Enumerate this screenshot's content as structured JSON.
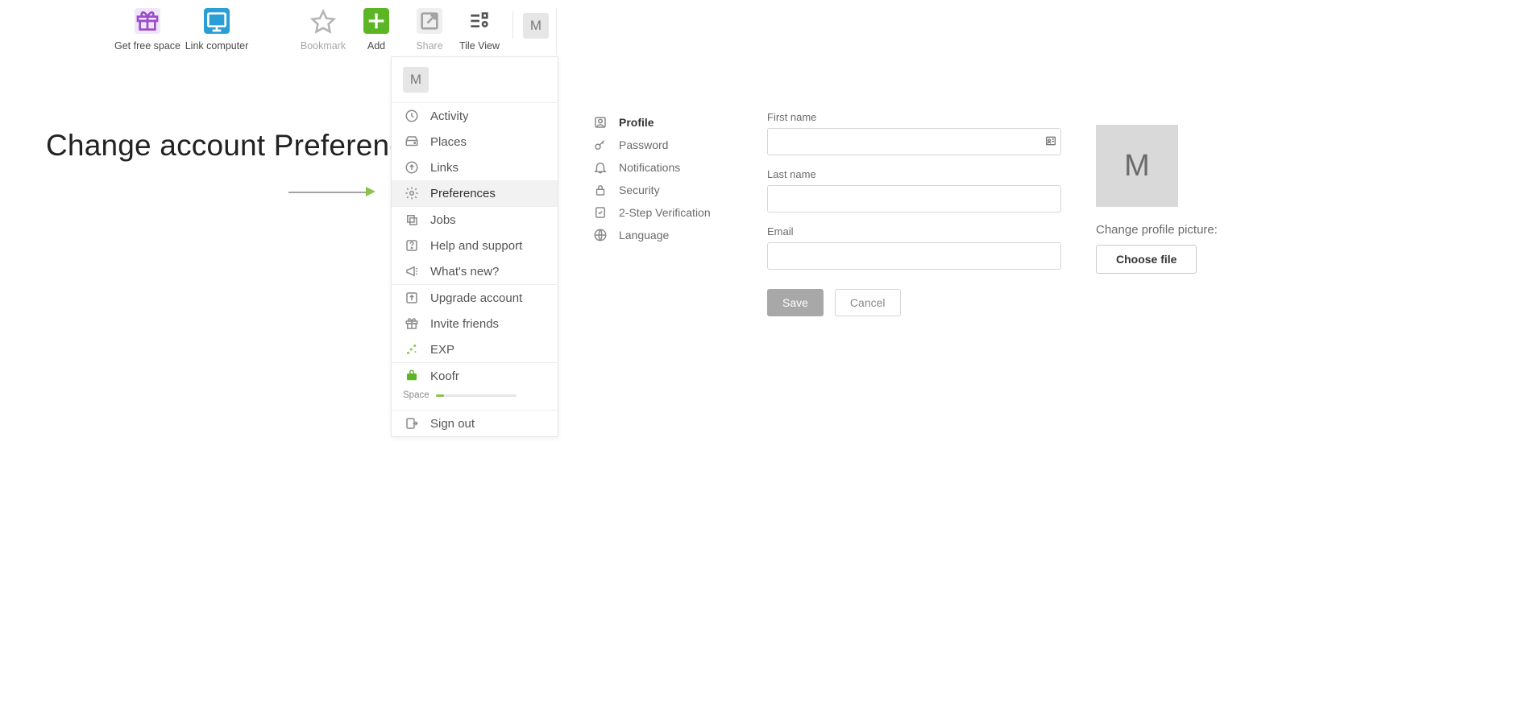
{
  "toolbar": {
    "items": [
      {
        "label": "Get free space"
      },
      {
        "label": "Link computer"
      },
      {
        "label": "Bookmark"
      },
      {
        "label": "Add"
      },
      {
        "label": "Share"
      },
      {
        "label": "Tile View"
      }
    ],
    "avatar_letter": "M"
  },
  "page_title": "Change account Preferences",
  "menu": {
    "avatar_letter": "M",
    "groups": [
      [
        "Activity",
        "Places",
        "Links",
        "Preferences"
      ],
      [
        "Jobs",
        "Help and support",
        "What's new?"
      ],
      [
        "Upgrade account",
        "Invite friends",
        "EXP"
      ],
      [
        "Koofr"
      ],
      [
        "Sign out"
      ]
    ],
    "space_label": "Space"
  },
  "prefs": [
    "Profile",
    "Password",
    "Notifications",
    "Security",
    "2-Step Verification",
    "Language"
  ],
  "form": {
    "first_name_label": "First name",
    "last_name_label": "Last name",
    "email_label": "Email",
    "first_name_value": "",
    "last_name_value": "",
    "email_value": "",
    "save_label": "Save",
    "cancel_label": "Cancel"
  },
  "avatar": {
    "letter": "M",
    "change_label": "Change profile picture:",
    "choose_label": "Choose file"
  }
}
